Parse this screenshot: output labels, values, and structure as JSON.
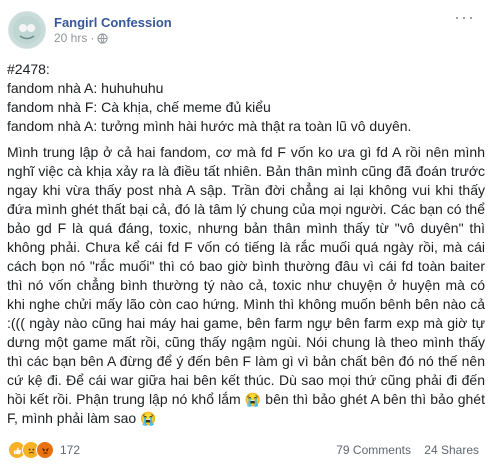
{
  "header": {
    "page_name": "Fangirl Confession",
    "time": "20 hrs",
    "dot": "·",
    "more": "···"
  },
  "post": {
    "lines": [
      "#2478:",
      "fandom nhà A: huhuhuhu",
      "fandom nhà F: Cà khịa, chế meme đủ kiểu",
      "fandom nhà A: tưởng mình hài hước mà thật ra toàn lũ vô duyên."
    ],
    "paragraph": "Mình trung lập ở cả hai fandom, cơ mà fd F vốn ko ưa gì fd A rồi nên mình nghĩ việc cà khịa xảy ra là điều tất nhiên. Bản thân mình cũng đã đoán trước ngay khi vừa thấy post nhà A sập. Trần đời chẳng ai lại không vui khi thấy đứa mình ghét thất bại cả, đó là tâm lý chung của mọi người. Các bạn có thể bảo gd F là quá đáng, toxic, nhưng bản thân mình thấy từ \"vô duyên\" thì không phải. Chưa kể cái fd F vốn có tiếng là rắc muối quá ngày rồi, mà cái cách bọn nó \"rắc muối\" thì có bao giờ bình thường đâu vì cái fd toàn baiter thì nó vốn chẳng bình thường tý nào cả, toxic như chuyện ở huyện mà có khi nghe chửi mấy lão còn cao hứng. Mình thì không muốn bênh bên nào cả :((( ngày nào cũng hai máy hai game, bên farm ngự bên farm exp mà giờ tự dưng một game mất rồi, cũng thấy ngậm ngùi. Nói chung là theo mình thấy thì các bạn bên A đừng để ý đến bên F làm gì vì bản chất bên đó nó thế nên cứ kệ đi. Để cái war giữa hai bên kết thúc. Dù sao mọi thứ cũng phải đi đến hồi kết rồi. Phận trung lập nó khổ lắm",
    "emoji_mid": "😭",
    "tail": " bên thì bảo ghét A bên thì bảo ghét F, mình phải làm sao ",
    "emoji_end": "😭"
  },
  "footer": {
    "reaction_count": "172",
    "comments": "79 Comments",
    "shares": "24 Shares",
    "reaction_icons": [
      "like-icon",
      "sad-icon",
      "angry-icon"
    ]
  },
  "colors": {
    "page_name": "#365899",
    "meta": "#90949c",
    "text": "#1c1e21"
  }
}
